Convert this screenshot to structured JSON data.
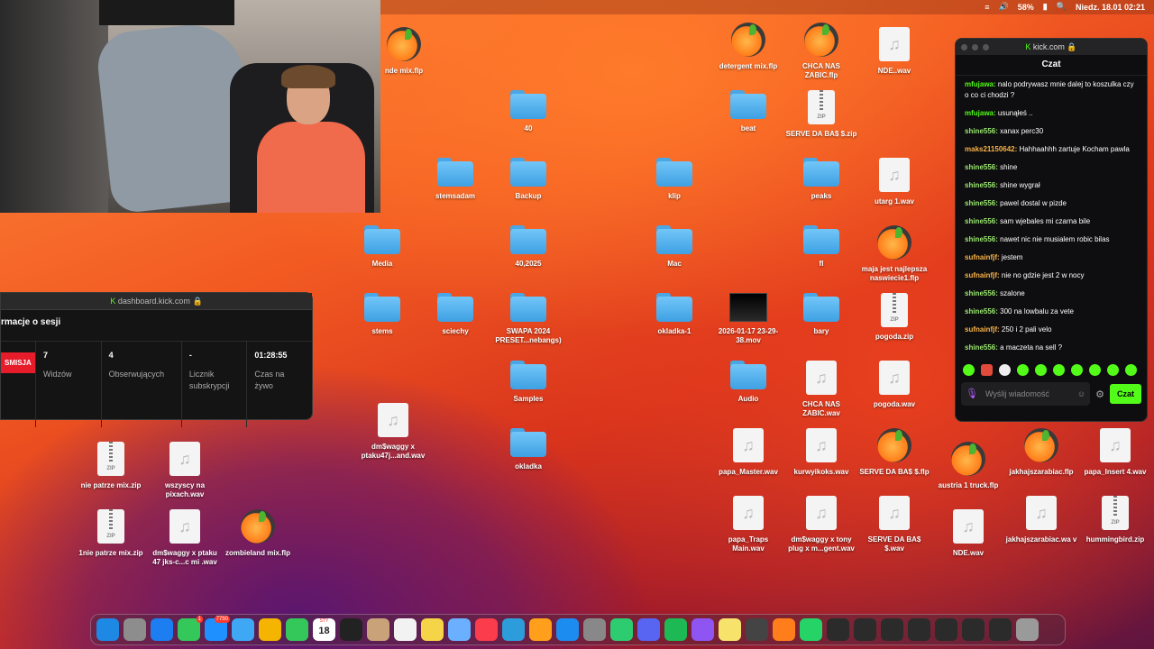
{
  "menubar": {
    "battery": "58%",
    "datetime": "Niedz. 18.01  02:21"
  },
  "desktop_icons": [
    {
      "label": "nde mix.flp",
      "type": "flp"
    },
    {
      "label": "detergent mix.flp",
      "type": "flp"
    },
    {
      "label": "CHCA NAS ZABIC.flp",
      "type": "flp"
    },
    {
      "label": "NDE..wav",
      "type": "wav"
    },
    {
      "label": "40",
      "type": "folder"
    },
    {
      "label": "beat",
      "type": "folder"
    },
    {
      "label": "SERVE DA BA$ $.zip",
      "type": "zip"
    },
    {
      "label": "stemsadam",
      "type": "folder"
    },
    {
      "label": "Backup",
      "type": "folder"
    },
    {
      "label": "klip",
      "type": "folder"
    },
    {
      "label": "peaks",
      "type": "folder"
    },
    {
      "label": "utarg 1.wav",
      "type": "wav"
    },
    {
      "label": "Media",
      "type": "folder"
    },
    {
      "label": "40,2025",
      "type": "folder"
    },
    {
      "label": "Mac",
      "type": "folder"
    },
    {
      "label": "fl",
      "type": "folder"
    },
    {
      "label": "maja jest najlepsza naswiecie1.flp",
      "type": "flp"
    },
    {
      "label": "stems",
      "type": "folder"
    },
    {
      "label": "sciechy",
      "type": "folder"
    },
    {
      "label": "SWAPA 2024 PRESET...nebangs)",
      "type": "folder"
    },
    {
      "label": "okladka-1",
      "type": "folder"
    },
    {
      "label": "2026-01-17 23-29-38.mov",
      "type": "mov"
    },
    {
      "label": "bary",
      "type": "folder"
    },
    {
      "label": "pogoda.zip",
      "type": "zip"
    },
    {
      "label": "Samples",
      "type": "folder"
    },
    {
      "label": "Audio",
      "type": "folder"
    },
    {
      "label": "CHCA NAS ZABIC.wav",
      "type": "wav"
    },
    {
      "label": "pogoda.wav",
      "type": "wav"
    },
    {
      "label": "dm$waggy x ptaku47j...and.wav",
      "type": "wav"
    },
    {
      "label": "okladka",
      "type": "folder"
    },
    {
      "label": "nie patrze mix.zip",
      "type": "zip"
    },
    {
      "label": "wszyscy na pixach.wav",
      "type": "wav"
    },
    {
      "label": "papa_Master.wav",
      "type": "wav"
    },
    {
      "label": "kurwyikoks.wav",
      "type": "wav"
    },
    {
      "label": "SERVE DA BA$ $.flp",
      "type": "flp"
    },
    {
      "label": "austria 1 truck.flp",
      "type": "flp"
    },
    {
      "label": "jakhajszarabiac.flp",
      "type": "flp"
    },
    {
      "label": "papa_Insert 4.wav",
      "type": "wav"
    },
    {
      "label": "1nie patrze mix.zip",
      "type": "zip"
    },
    {
      "label": "dm$waggy x ptaku 47 jks-c...c mi .wav",
      "type": "wav"
    },
    {
      "label": "zombieland mix.flp",
      "type": "flp"
    },
    {
      "label": "papa_Traps Main.wav",
      "type": "wav"
    },
    {
      "label": "dm$waggy x tony plug x m...gent.wav",
      "type": "wav"
    },
    {
      "label": "SERVE DA BA$ $.wav",
      "type": "wav"
    },
    {
      "label": "NDE.wav",
      "type": "wav"
    },
    {
      "label": "jakhajszarabiac.wa v",
      "type": "wav"
    },
    {
      "label": "hummingbird.zip",
      "type": "zip"
    }
  ],
  "dashboard": {
    "url": "dashboard.kick.com",
    "title": "rmacje o sesji",
    "badge": "SMISJA",
    "stats": [
      {
        "value": "7",
        "label": "Widzów"
      },
      {
        "value": "4",
        "label": "Obserwujących"
      },
      {
        "value": "-",
        "label": "Licznik subskrypcji"
      },
      {
        "value": "01:28:55",
        "label": "Czas na żywo"
      }
    ]
  },
  "chat": {
    "url": "kick.com",
    "title": "Czat",
    "messages": [
      {
        "user": "mfujawa",
        "text": "nalo podrywasz mnie dalej to koszulka czy o co ci chodzi ?",
        "color": "lime"
      },
      {
        "user": "mfujawa",
        "text": "usunąłeś ..",
        "color": "lime"
      },
      {
        "user": "shine556",
        "text": "xanax perc30",
        "color": "green"
      },
      {
        "user": "maks21150642",
        "text": "Hahhaahhh zartuje Kocham pawla",
        "color": "orange"
      },
      {
        "user": "shine556",
        "text": "shine",
        "color": "green"
      },
      {
        "user": "shine556",
        "text": "shine wygrał",
        "color": "green"
      },
      {
        "user": "shine556",
        "text": "pawel dostal w pizde",
        "color": "green"
      },
      {
        "user": "shine556",
        "text": "sam wjebales mi czarna bile",
        "color": "green"
      },
      {
        "user": "shine556",
        "text": "nawet nic nie musialem robic bilas",
        "color": "green"
      },
      {
        "user": "sufnainfjf",
        "text": "jestem",
        "color": "orange"
      },
      {
        "user": "sufnainfjf",
        "text": "nie no gdzie jest 2 w nocy",
        "color": "orange"
      },
      {
        "user": "shine556",
        "text": "szalone",
        "color": "green"
      },
      {
        "user": "shine556",
        "text": "300 na lowbalu za vete",
        "color": "green"
      },
      {
        "user": "sufnainfjf",
        "text": "250 i 2 pali velo",
        "color": "orange"
      },
      {
        "user": "shine556",
        "text": "a maczeta na sell ?",
        "color": "green"
      }
    ],
    "input_placeholder": "Wyślij wiadomość",
    "send_label": "Czat"
  },
  "dock": {
    "calendar_month": "STY",
    "calendar_day": "18",
    "messages_badge": "1",
    "mail_badge": "7750",
    "colors": [
      "#1e88e5",
      "#8d8d8d",
      "#1c7ef0",
      "#34c759",
      "#1e90ff",
      "#3fa8f4",
      "#f4b400",
      "#34c759",
      "#222",
      "#222",
      "#c9a27a",
      "#f2f2f2",
      "#f5d547",
      "#6ab0ff",
      "#fa3c4c",
      "#2d9cdb",
      "#ff9f1c",
      "#1c8cf0",
      "#888",
      "#2ecc71",
      "#5865f2",
      "#1db954",
      "#8e55f2",
      "#f7e26b",
      "#444",
      "#ff7d1a",
      "#25d366",
      "#2b2b2b",
      "#2b2b2b",
      "#2b2b2b",
      "#2b2b2b",
      "#2b2b2b",
      "#2b2b2b",
      "#2b2b2b",
      "#9a9a9a"
    ]
  }
}
